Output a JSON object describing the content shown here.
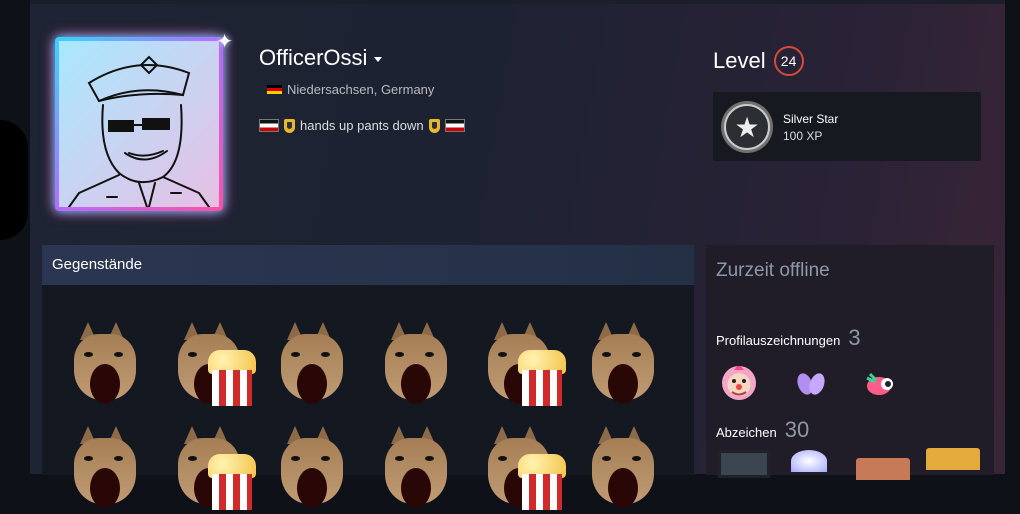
{
  "profile": {
    "persona_name": "OfficerOssi",
    "location": "Niedersachsen, Germany",
    "summary_text": "hands up pants down"
  },
  "level": {
    "label": "Level",
    "value": "24"
  },
  "xp_badge": {
    "name": "Silver Star",
    "xp": "100 XP"
  },
  "items": {
    "title": "Gegenstände",
    "grid": [
      {
        "kind": "pop-cat"
      },
      {
        "kind": "pop-cat-popcorn"
      },
      {
        "kind": "pop-cat"
      },
      {
        "kind": "pop-cat"
      },
      {
        "kind": "pop-cat-popcorn"
      },
      {
        "kind": "pop-cat"
      },
      {
        "kind": "pop-cat"
      },
      {
        "kind": "pop-cat-popcorn"
      },
      {
        "kind": "pop-cat"
      },
      {
        "kind": "pop-cat"
      },
      {
        "kind": "pop-cat-popcorn"
      },
      {
        "kind": "pop-cat"
      }
    ]
  },
  "side": {
    "status": "Zurzeit offline",
    "awards_label": "Profilauszeichnungen",
    "awards_count": "3",
    "badges_label": "Abzeichen",
    "badges_count": "30"
  },
  "colors": {
    "level_ring": "#d54a3a",
    "items_header": "#2b3752",
    "frame_glow_cyan": "#36d6ff",
    "frame_glow_pink": "#ff4fa2"
  }
}
